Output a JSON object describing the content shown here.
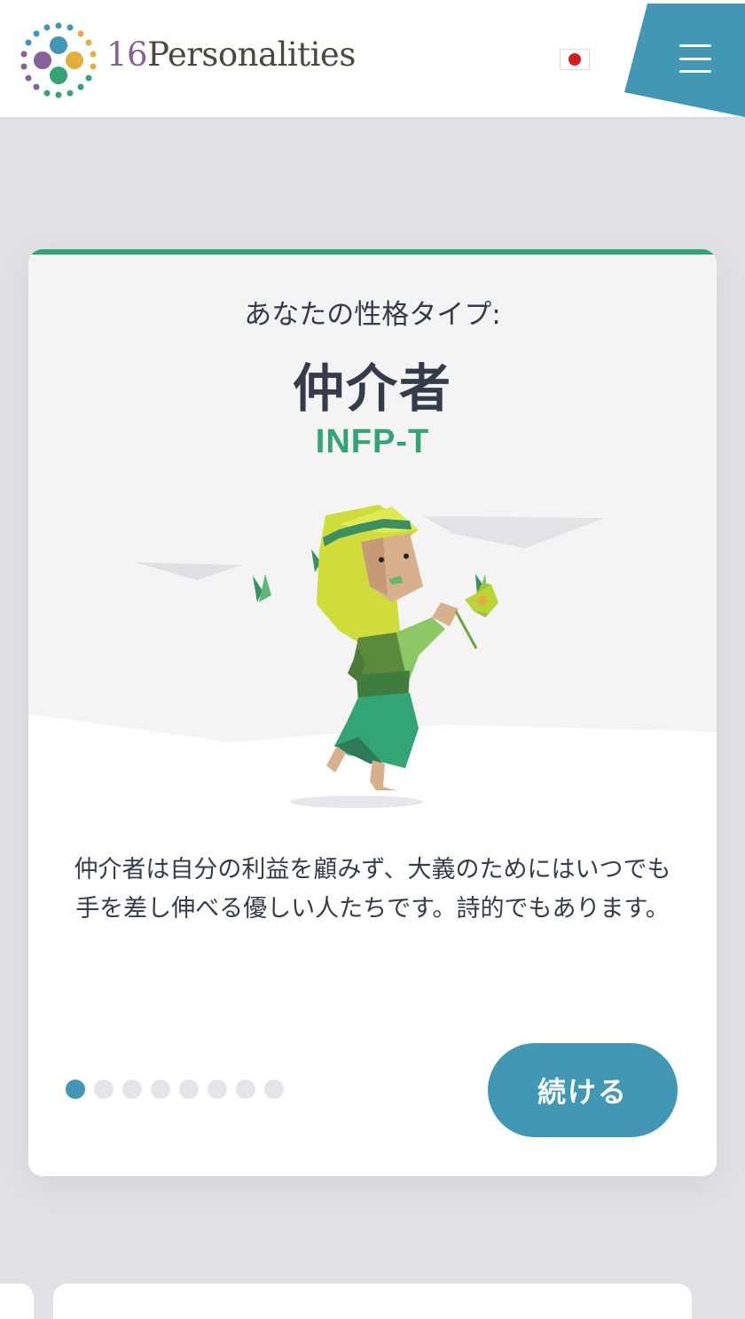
{
  "header": {
    "brand_number": "16",
    "brand_name": "Personalities",
    "language_flag_icon": "japan-flag-icon",
    "menu_icon": "hamburger-icon"
  },
  "card": {
    "label": "あなたの性格タイプ:",
    "type_name": "仲介者",
    "type_code": "INFP-T",
    "description": "仲介者は自分の利益を顧みず、大義のためにはいつでも手を差し伸べる優しい人たちです。詩的でもあります。",
    "pagination": {
      "total": 8,
      "current": 1
    },
    "continue_label": "続ける"
  },
  "colors": {
    "accent_green": "#33a474",
    "button_blue": "#4298b4",
    "text_dark": "#343c4b",
    "page_background": "#dfe1e5"
  }
}
